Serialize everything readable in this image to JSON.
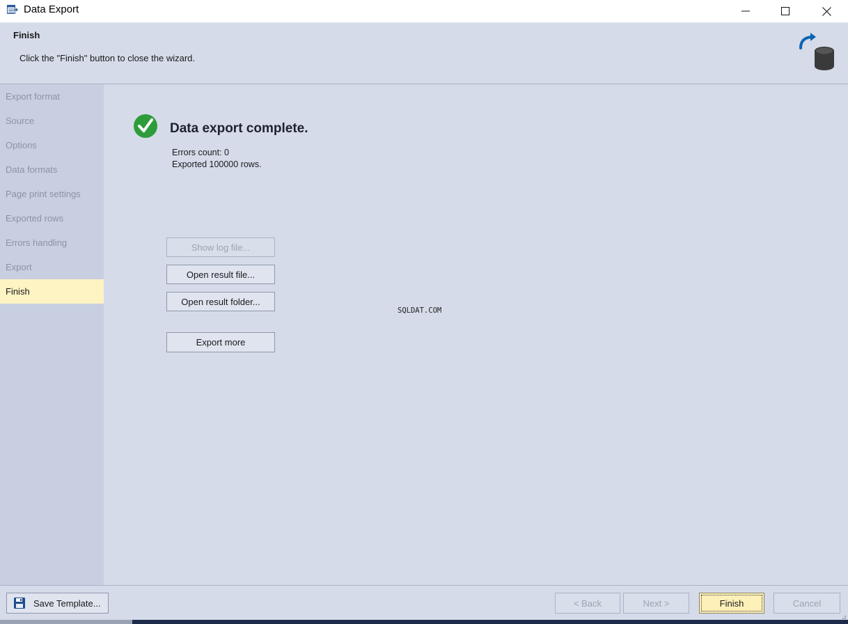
{
  "window": {
    "title": "Data Export"
  },
  "header": {
    "title": "Finish",
    "subtitle": "Click the \"Finish\" button to close the wizard."
  },
  "sidebar": {
    "items": [
      {
        "label": "Export format",
        "active": false
      },
      {
        "label": "Source",
        "active": false
      },
      {
        "label": "Options",
        "active": false
      },
      {
        "label": "Data formats",
        "active": false
      },
      {
        "label": "Page print settings",
        "active": false
      },
      {
        "label": "Exported rows",
        "active": false
      },
      {
        "label": "Errors handling",
        "active": false
      },
      {
        "label": "Export",
        "active": false
      },
      {
        "label": "Finish",
        "active": true
      }
    ]
  },
  "main": {
    "title": "Data export complete.",
    "errors_count": "Errors count: 0",
    "exported_rows": "Exported 100000 rows.",
    "buttons": {
      "show_log": "Show log file...",
      "open_result_file": "Open result file...",
      "open_result_folder": "Open result folder...",
      "export_more": "Export more"
    },
    "watermark": "SQLDAT.COM"
  },
  "footer": {
    "save_template": "Save Template...",
    "back": "< Back",
    "next": "Next >",
    "finish": "Finish",
    "cancel": "Cancel"
  },
  "colors": {
    "accent": "#0a64b4",
    "success": "#2e9c3a",
    "active_nav": "#fdf3c3",
    "background": "#d5dbe9"
  }
}
